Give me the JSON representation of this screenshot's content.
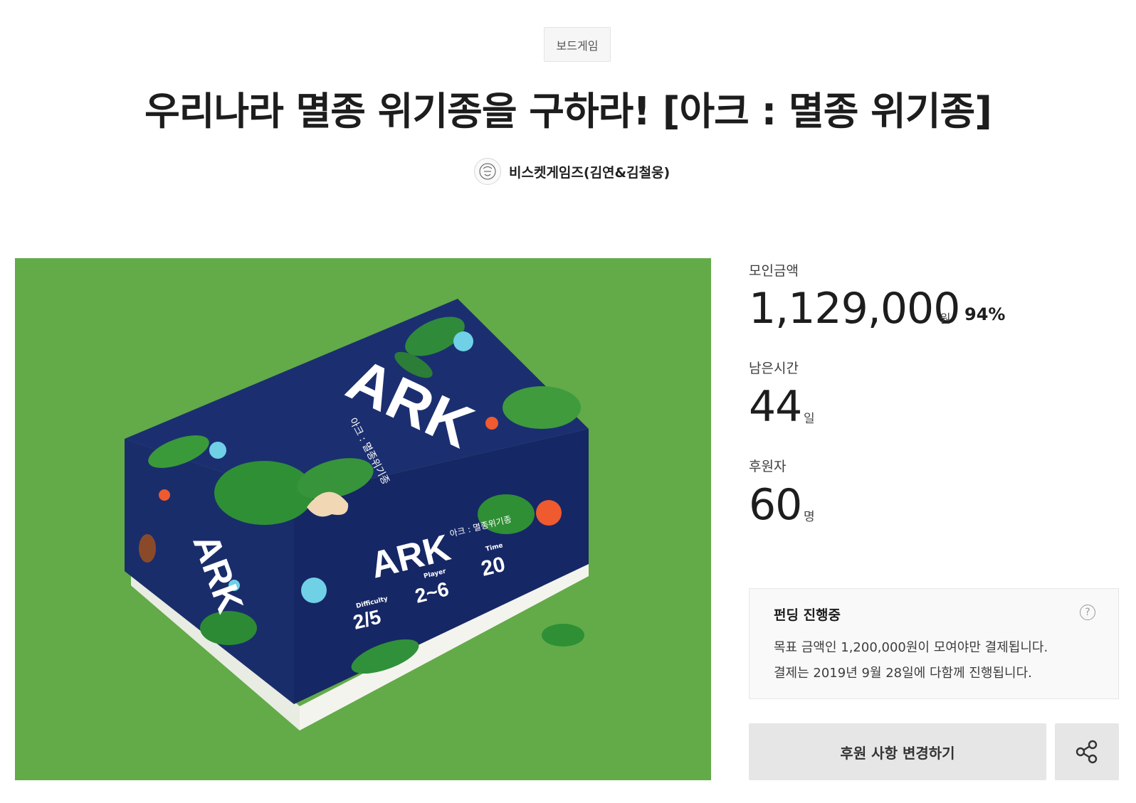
{
  "category": "보드게임",
  "title": "우리나라 멸종 위기종을 구하라! [아크 : 멸종 위기종]",
  "creator": {
    "name": "비스켓게임즈(김연&김철웅)"
  },
  "hero_image": {
    "description_icon": "board-game-box-image",
    "box_brand": "ARK",
    "box_subtitle": "아크 : 멸종위기종",
    "difficulty_label": "Difficulty",
    "difficulty_value": "2/5",
    "player_label": "Player",
    "player_value": "2~6",
    "time_label": "Time",
    "time_value": "20",
    "background_color": "#62ab48",
    "box_color": "#15255e"
  },
  "stats": {
    "raised_label": "모인금액",
    "raised_value": "1,129,000",
    "raised_unit": "원",
    "percent": "94%",
    "time_label": "남은시간",
    "time_value": "44",
    "time_unit": "일",
    "backers_label": "후원자",
    "backers_value": "60",
    "backers_unit": "명"
  },
  "funding_box": {
    "title": "펀딩 진행중",
    "help_icon": "?",
    "line1": "목표 금액인 1,200,000원이 모여야만 결제됩니다.",
    "line2": "결제는 2019년 9월 28일에 다함께 진행됩니다."
  },
  "actions": {
    "change_button_label": "후원 사항 변경하기",
    "share_icon": "share-icon"
  }
}
